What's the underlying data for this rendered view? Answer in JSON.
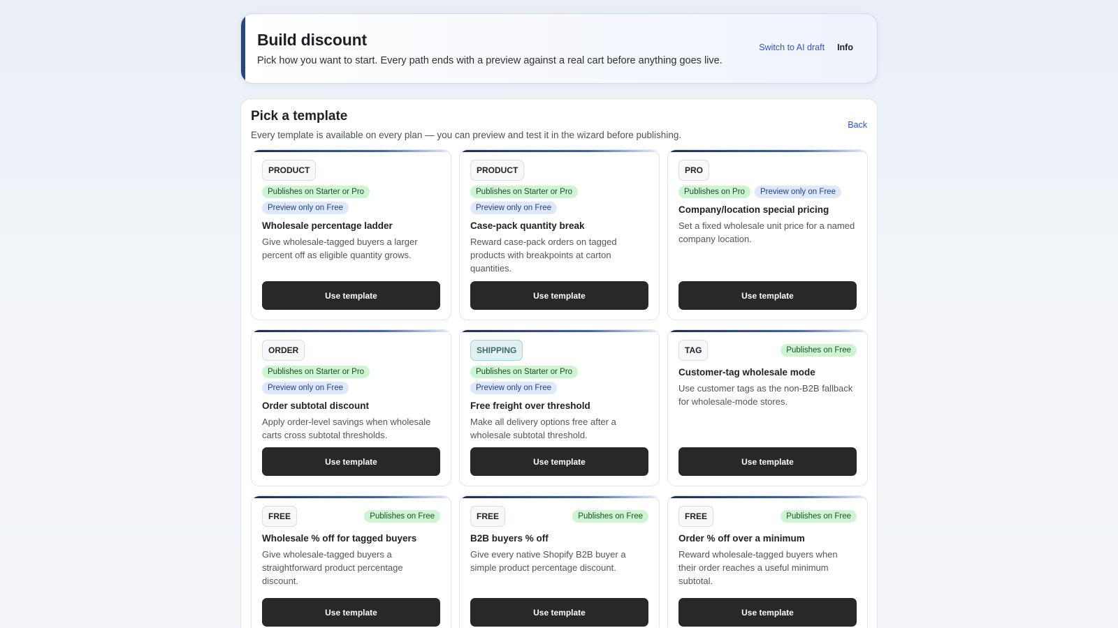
{
  "header": {
    "title": "Build discount",
    "subtitle": "Pick how you want to start. Every path ends with a preview against a real cart before anything goes live.",
    "switch_label": "Switch to AI draft",
    "info_label": "Info"
  },
  "panel": {
    "title": "Pick a template",
    "subtitle": "Every template is available on every plan — you can preview and test it in the wizard before publishing.",
    "back_label": "Back"
  },
  "colors": {
    "accent": "#27467e",
    "button_bg": "#272829",
    "chip_green": "#cdf5d2",
    "chip_blue": "#dde8fb",
    "link": "#2e56b8"
  },
  "templates": [
    {
      "category": "PRODUCT",
      "chips": [
        "Publishes on Starter or Pro",
        "Preview only on Free"
      ],
      "title": "Wholesale percentage ladder",
      "description": "Give wholesale-tagged buyers a larger percent off as eligible quantity grows.",
      "button": "Use template"
    },
    {
      "category": "PRODUCT",
      "chips": [
        "Publishes on Starter or Pro",
        "Preview only on Free"
      ],
      "title": "Case-pack quantity break",
      "description": "Reward case-pack orders on tagged products with breakpoints at carton quantities.",
      "button": "Use template"
    },
    {
      "category": "PRO",
      "chips": [
        "Publishes on Pro",
        "Preview only on Free"
      ],
      "title": "Company/location special pricing",
      "description": "Set a fixed wholesale unit price for a named company location.",
      "button": "Use template"
    },
    {
      "category": "ORDER",
      "chips": [
        "Publishes on Starter or Pro",
        "Preview only on Free"
      ],
      "title": "Order subtotal discount",
      "description": "Apply order-level savings when wholesale carts cross subtotal thresholds.",
      "button": "Use template"
    },
    {
      "category": "SHIPPING",
      "chips": [
        "Publishes on Starter or Pro",
        "Preview only on Free"
      ],
      "title": "Free freight over threshold",
      "description": "Make all delivery options free after a wholesale subtotal threshold.",
      "button": "Use template"
    },
    {
      "category": "TAG",
      "chips": [
        "Publishes on Free"
      ],
      "title": "Customer-tag wholesale mode",
      "description": "Use customer tags as the non-B2B fallback for wholesale-mode stores.",
      "button": "Use template"
    },
    {
      "category": "FREE",
      "chips": [
        "Publishes on Free"
      ],
      "title": "Wholesale % off for tagged buyers",
      "description": "Give wholesale-tagged buyers a straightforward product percentage discount.",
      "button": "Use template"
    },
    {
      "category": "FREE",
      "chips": [
        "Publishes on Free"
      ],
      "title": "B2B buyers % off",
      "description": "Give every native Shopify B2B buyer a simple product percentage discount.",
      "button": "Use template"
    },
    {
      "category": "FREE",
      "chips": [
        "Publishes on Free"
      ],
      "title": "Order % off over a minimum",
      "description": "Reward wholesale-tagged buyers when their order reaches a useful minimum subtotal.",
      "button": "Use template"
    }
  ]
}
